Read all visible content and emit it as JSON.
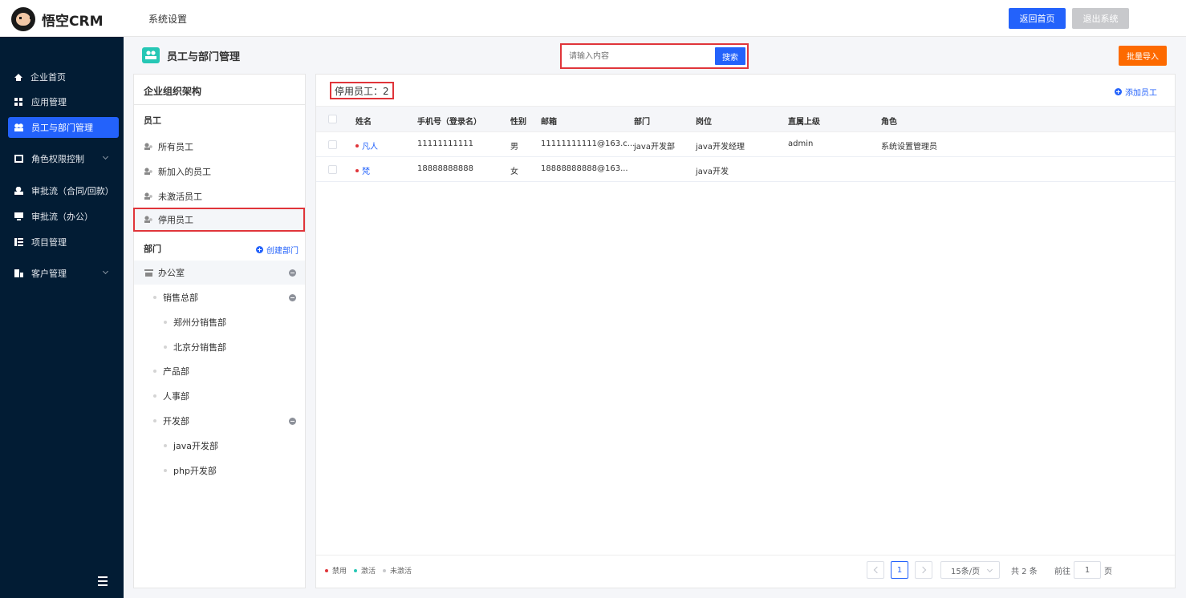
{
  "app": {
    "logo_text": "悟空CRM",
    "section": "系统设置"
  },
  "header": {
    "home_button": "返回首页",
    "exit_button": "退出系统"
  },
  "sidebar": {
    "items": [
      {
        "label": "企业首页",
        "icon": "home-icon"
      },
      {
        "label": "应用管理",
        "icon": "grid-icon"
      },
      {
        "label": "员工与部门管理",
        "icon": "people-icon",
        "active": true
      },
      {
        "label": "角色权限控制",
        "icon": "box-icon",
        "has_submenu": true
      },
      {
        "label": "审批流（合同/回款）",
        "icon": "person-icon"
      },
      {
        "label": "审批流（办公）",
        "icon": "monitor-icon"
      },
      {
        "label": "项目管理",
        "icon": "list-icon"
      },
      {
        "label": "客户管理",
        "icon": "building-icon",
        "has_submenu": true
      }
    ]
  },
  "page": {
    "title": "员工与部门管理",
    "search_placeholder": "请输入内容",
    "search_button": "搜索",
    "import_button": "批量导入"
  },
  "org": {
    "title": "企业组织架构",
    "employee_section": "员工",
    "employee_filters": [
      "所有员工",
      "新加入的员工",
      "未激活员工",
      "停用员工"
    ],
    "selected_filter": "停用员工",
    "dept_section": "部门",
    "create_dept": "创建部门",
    "departments": [
      {
        "name": "办公室",
        "level": 0,
        "expandable": true
      },
      {
        "name": "销售总部",
        "level": 1,
        "expandable": true
      },
      {
        "name": "郑州分销售部",
        "level": 2
      },
      {
        "name": "北京分销售部",
        "level": 2
      },
      {
        "name": "产品部",
        "level": 1
      },
      {
        "name": "人事部",
        "level": 1
      },
      {
        "name": "开发部",
        "level": 1,
        "expandable": true
      },
      {
        "name": "java开发部",
        "level": 2
      },
      {
        "name": "php开发部",
        "level": 2
      }
    ]
  },
  "table": {
    "count_label": "停用员工：2",
    "add_button": "添加员工",
    "columns": [
      "姓名",
      "手机号（登录名）",
      "性别",
      "邮箱",
      "部门",
      "岗位",
      "直属上级",
      "角色"
    ],
    "rows": [
      {
        "name": "凡人",
        "phone": "11111111111",
        "gender": "男",
        "email": "11111111111@163.c...",
        "dept": "java开发部",
        "post": "java开发经理",
        "manager": "admin",
        "role": "系统设置管理员"
      },
      {
        "name": "梵",
        "phone": "18888888888",
        "gender": "女",
        "email": "18888888888@163...",
        "dept": "",
        "post": "java开发",
        "manager": "",
        "role": ""
      }
    ]
  },
  "legend": [
    {
      "label": "禁用",
      "color": "#e0353a"
    },
    {
      "label": "激活",
      "color": "#26c7b5"
    },
    {
      "label": "未激活",
      "color": "#c8c9cc"
    }
  ],
  "pagination": {
    "current_page": "1",
    "page_size": "15条/页",
    "total": "共 2 条",
    "goto_label": "前往",
    "goto_value": "1",
    "page_unit": "页"
  }
}
